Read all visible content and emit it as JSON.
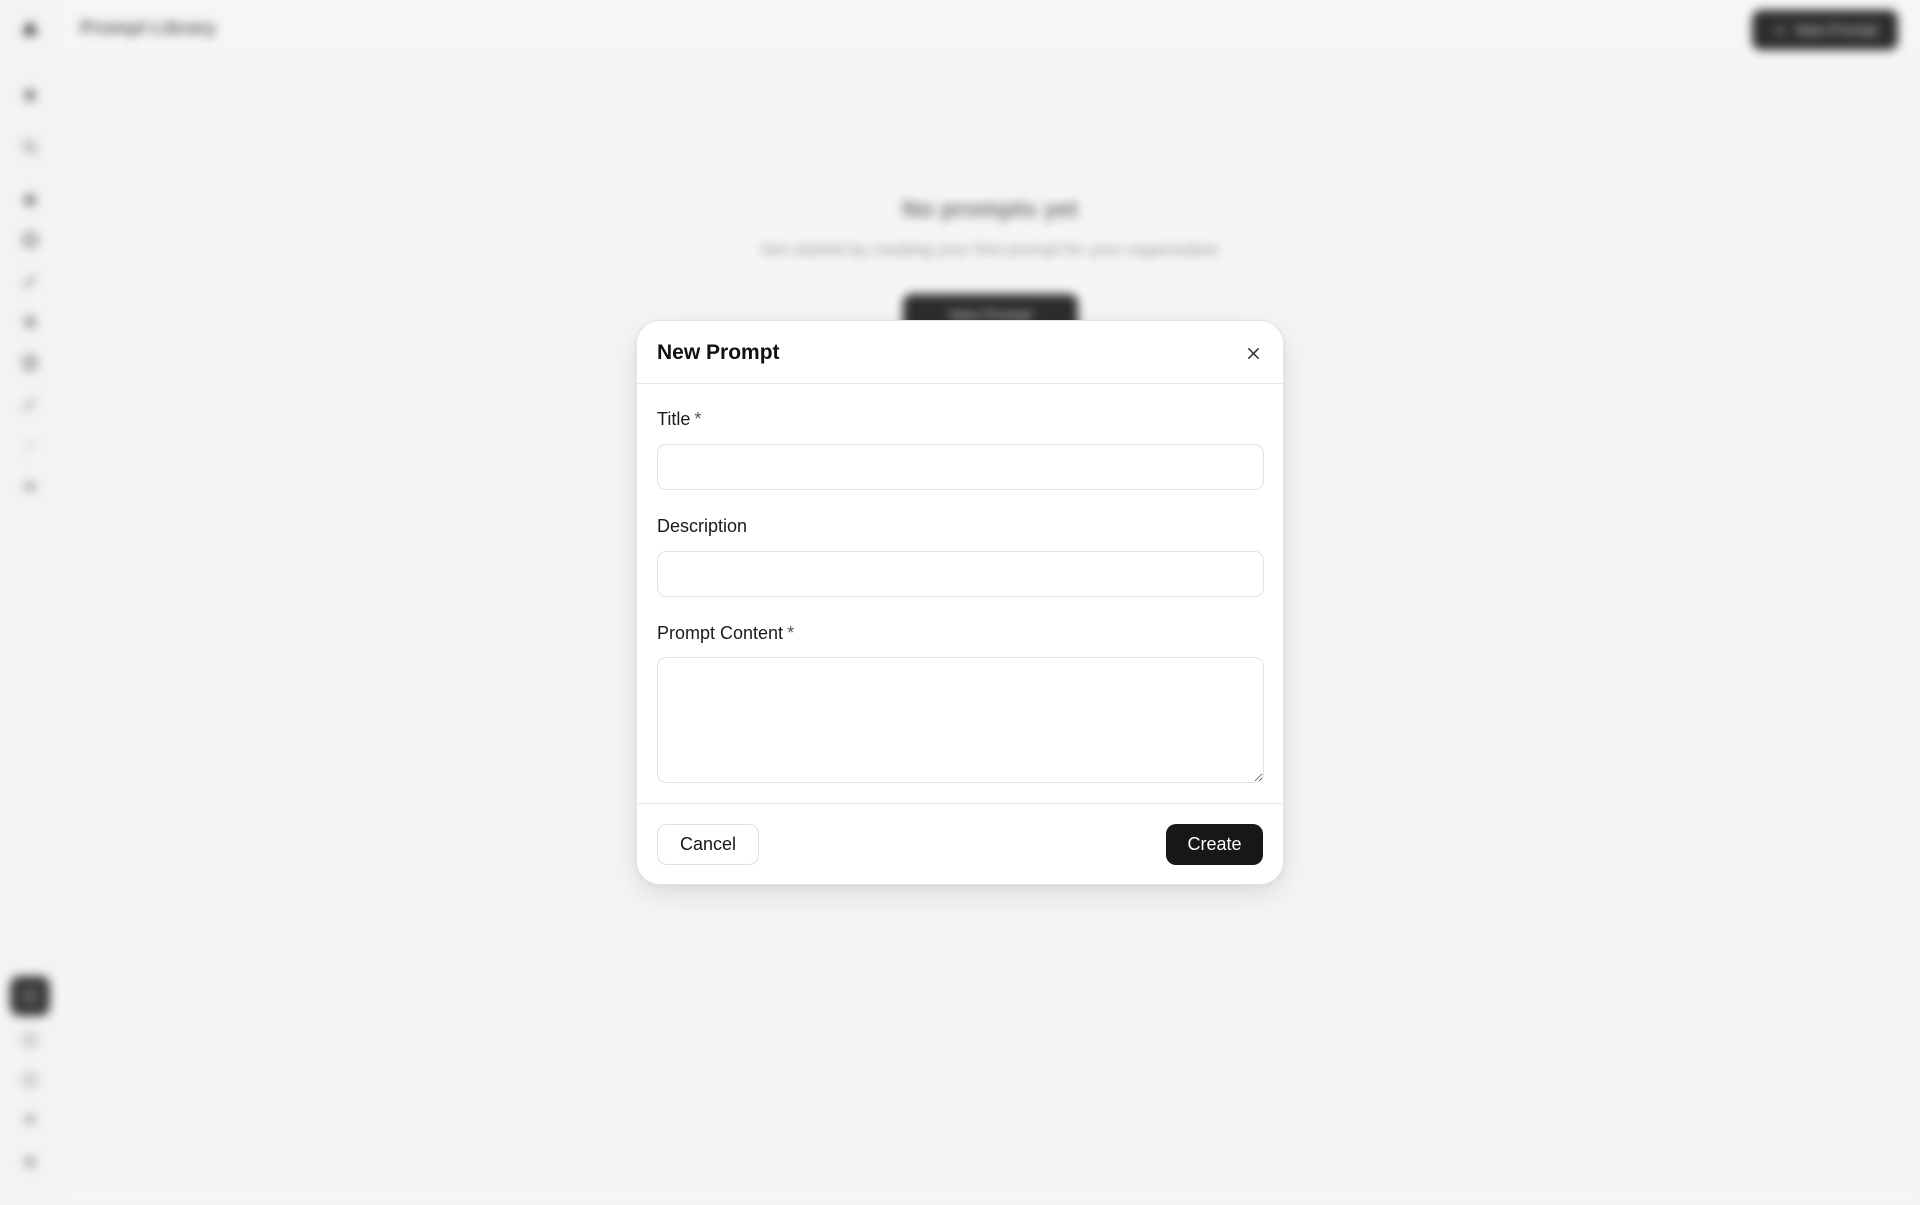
{
  "background": {
    "header_title": "Prompt Library",
    "header_button_label": "New Prompt",
    "empty_state": {
      "title": "No prompts yet",
      "subtitle": "Get started by creating your first prompt for your organization",
      "button_label": "New Prompt"
    }
  },
  "modal": {
    "title": "New Prompt",
    "close_icon": "close-icon",
    "fields": {
      "title": {
        "label": "Title",
        "required_mark": "*",
        "value": "",
        "placeholder": ""
      },
      "description": {
        "label": "Description",
        "value": "",
        "placeholder": ""
      },
      "content": {
        "label": "Prompt Content",
        "required_mark": "*",
        "value": "",
        "placeholder": ""
      }
    },
    "cancel_label": "Cancel",
    "create_label": "Create"
  },
  "colors": {
    "primary_button": "#171717",
    "background": "#f5f5f5"
  }
}
